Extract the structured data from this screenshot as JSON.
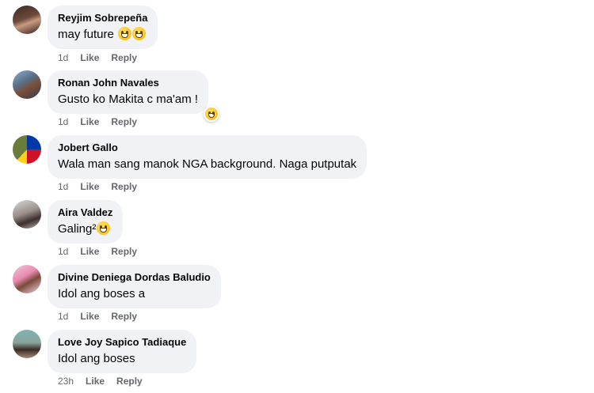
{
  "comments": [
    {
      "author": "Reyjim Sobrepeña",
      "text": "may future",
      "time": "1d",
      "like": "Like",
      "reply": "Reply",
      "emoji": "grinning-face-icon x2"
    },
    {
      "author": "Ronan John Navales",
      "text": "Gusto ko Makita c ma'am !",
      "time": "1d",
      "like": "Like",
      "reply": "Reply",
      "reaction": "haha-reaction-icon"
    },
    {
      "author": "Jobert Gallo",
      "text": "Wala man sang manok NGA background. Naga putputak",
      "time": "1d",
      "like": "Like",
      "reply": "Reply"
    },
    {
      "author": "Aira Valdez",
      "text": "Galing²",
      "time": "1d",
      "like": "Like",
      "reply": "Reply",
      "emoji": "kissing-face-icon"
    },
    {
      "author": "Divine Deniega Dordas Baludio",
      "text": "Idol ang boses a",
      "time": "1d",
      "like": "Like",
      "reply": "Reply"
    },
    {
      "author": "Love Joy Sapico Tadiaque",
      "text": "Idol ang boses",
      "time": "23h",
      "like": "Like",
      "reply": "Reply"
    }
  ]
}
